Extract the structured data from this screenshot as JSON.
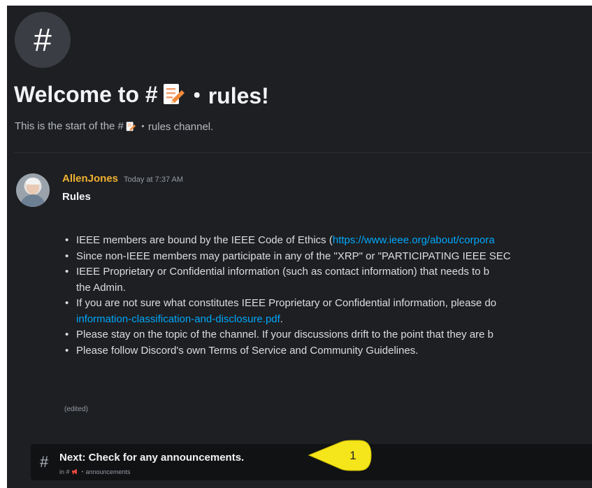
{
  "channel": {
    "icon": "hash-icon",
    "hash": "#",
    "welcome_prefix": "Welcome to #",
    "welcome_suffix": " ・rules!",
    "start_prefix": "This is the start of the #",
    "start_suffix": " ・rules channel."
  },
  "message": {
    "author": "AllenJones",
    "timestamp": "Today at 7:37 AM",
    "title": "Rules",
    "rules": [
      {
        "text": "IEEE members are bound by the IEEE Code of Ethics (",
        "link": "https://www.ieee.org/about/corpora"
      },
      {
        "text": "Since non-IEEE members may participate in any of the \"XRP\" or \"PARTICIPATING IEEE SEC"
      },
      {
        "text": "IEEE Proprietary or Confidential information (such as contact information) that needs to b",
        "cont": "the Admin."
      },
      {
        "text": "If you are not sure what constitutes IEEE Proprietary or Confidential information, please do",
        "cont_link": "information-classification-and-disclosure.pdf",
        "cont_tail": "."
      },
      {
        "text": "Please stay on the topic of the channel. If your discussions drift to the point that they are b"
      },
      {
        "text": "Please follow Discord's own Terms of Service and Community Guidelines."
      }
    ],
    "edited_label": "(edited)"
  },
  "next": {
    "hash": "#",
    "title": "Next: Check for any announcements.",
    "sub_prefix": "in #",
    "sub_channel": " ・announcements"
  },
  "callout": {
    "number": "1",
    "color": "#f5e51b"
  },
  "colors": {
    "background": "#1e1f22",
    "author": "#f0b232",
    "link": "#00a8fc",
    "next_bar": "#111214"
  }
}
